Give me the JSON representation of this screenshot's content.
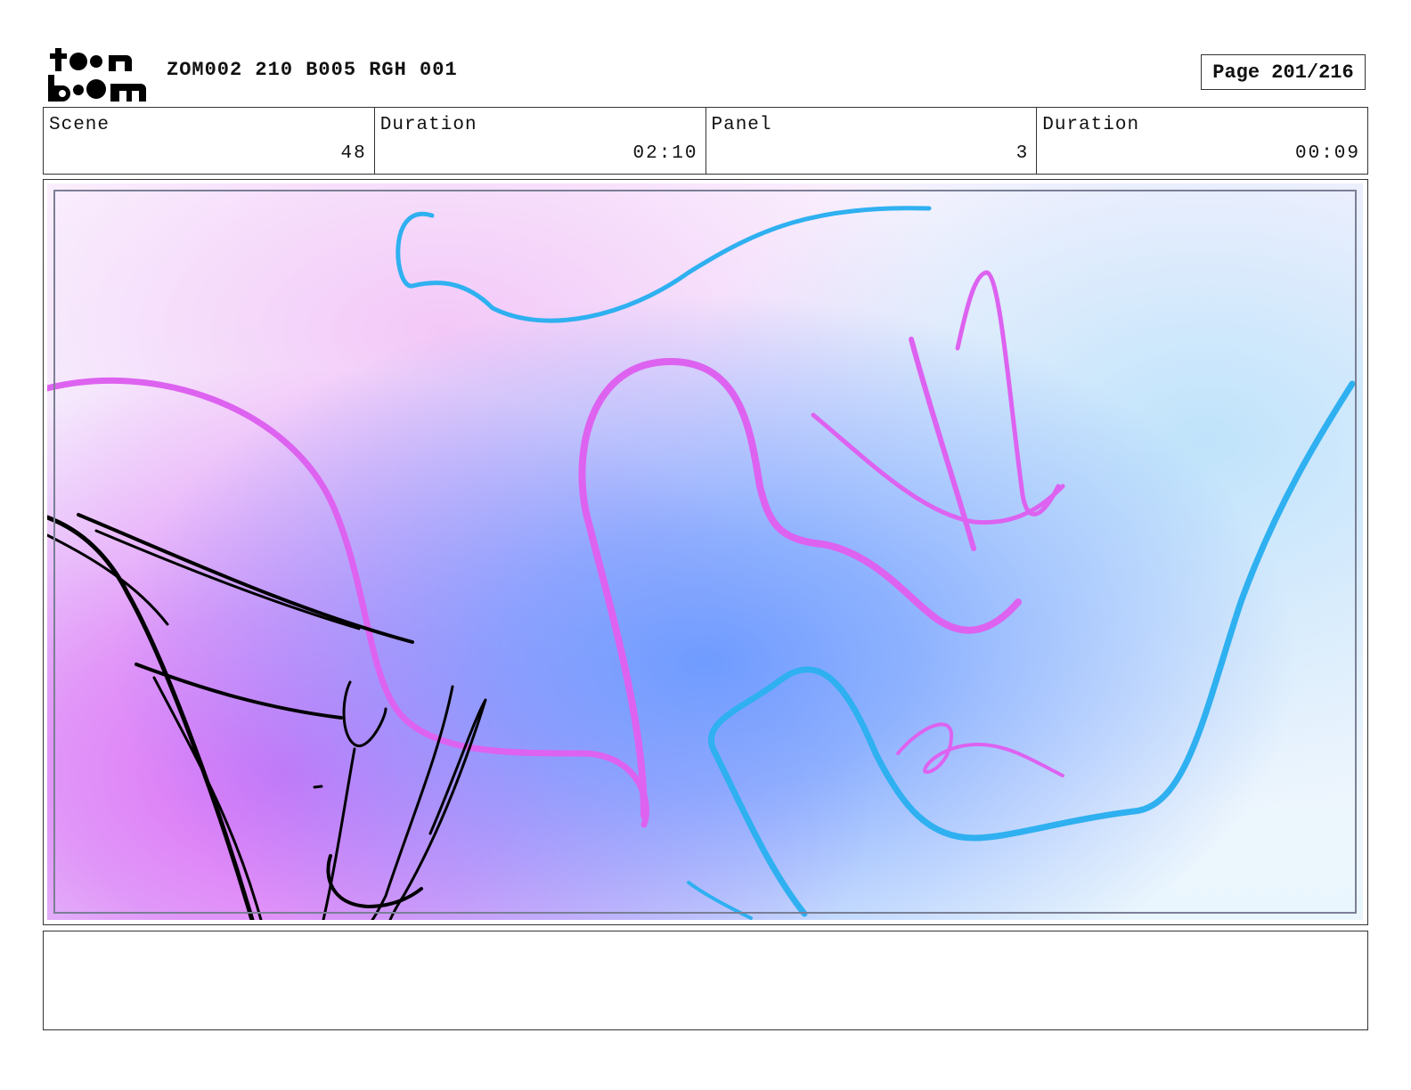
{
  "header": {
    "logo_top": "t●●n",
    "logo_bottom": "b●●m",
    "title": "ZOM002 210 B005 RGH 001",
    "page": "Page 201/216"
  },
  "info": {
    "scene_label": "Scene",
    "scene_value": "48",
    "scene_duration_label": "Duration",
    "scene_duration_value": "02:10",
    "panel_label": "Panel",
    "panel_value": "3",
    "panel_duration_label": "Duration",
    "panel_duration_value": "00:09"
  },
  "panel": {
    "stroke_colors": {
      "pink": "#dd62f0",
      "blue": "#2fb0f0",
      "ink": "#000000"
    }
  },
  "notes": {
    "text": ""
  }
}
